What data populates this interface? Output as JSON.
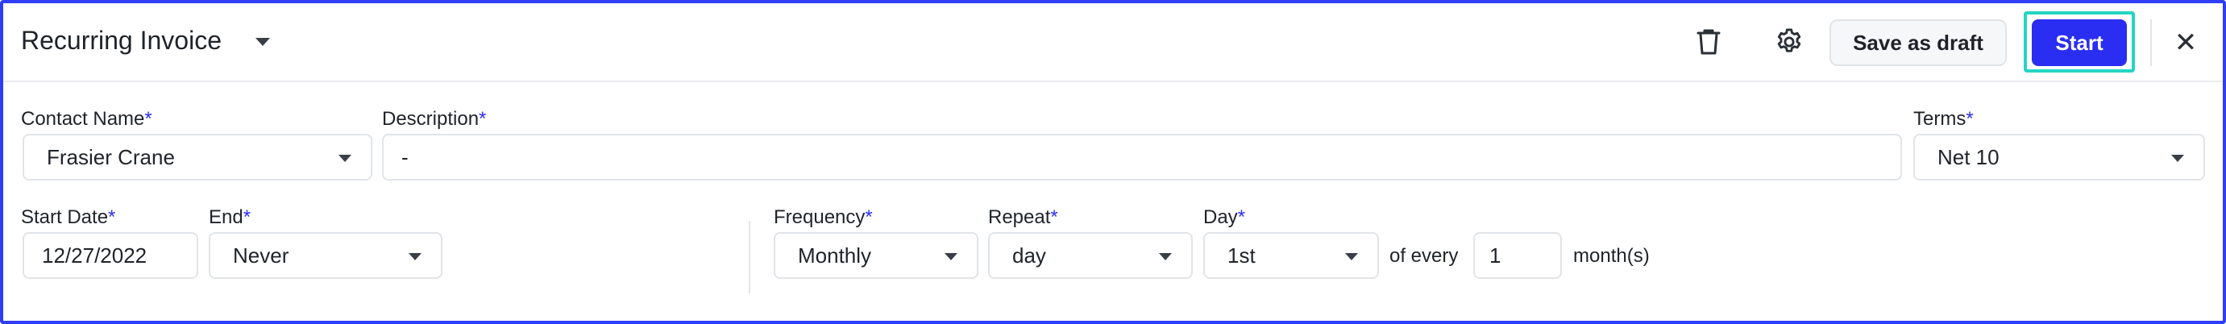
{
  "header": {
    "title": "Recurring Invoice",
    "actions": {
      "delete_icon": "trash-icon",
      "settings_icon": "gear-icon",
      "save_draft_label": "Save as draft",
      "start_label": "Start",
      "close_glyph": "✕"
    }
  },
  "form": {
    "contact": {
      "label": "Contact Name",
      "required_mark": "*",
      "value": "Frasier Crane"
    },
    "description": {
      "label": "Description",
      "required_mark": "*",
      "value": "-"
    },
    "terms": {
      "label": "Terms",
      "required_mark": "*",
      "value": "Net 10"
    },
    "start_date": {
      "label": "Start Date",
      "required_mark": "*",
      "value": "12/27/2022"
    },
    "end": {
      "label": "End",
      "required_mark": "*",
      "value": "Never"
    },
    "frequency": {
      "label": "Frequency",
      "required_mark": "*",
      "value": "Monthly"
    },
    "repeat": {
      "label": "Repeat",
      "required_mark": "*",
      "value": "day"
    },
    "day": {
      "label": "Day",
      "required_mark": "*",
      "value": "1st"
    },
    "of_every_text": "of every",
    "interval_value": "1",
    "unit_text": "month(s)"
  },
  "colors": {
    "accent": "#2a2ef2",
    "focus_ring": "#23d5c2",
    "frame_border": "#2f3df5"
  }
}
